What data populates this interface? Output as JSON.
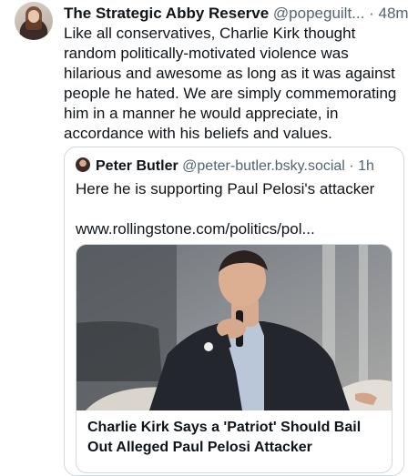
{
  "post": {
    "author": "The Strategic Abby Reserve",
    "handle": "@popeguilt...",
    "separator": "·",
    "time": "48m",
    "text": "Like all conservatives, Charlie Kirk thought random politically-motivated violence was hilarious and awesome as long as it was against people he hated. We are simply commemorating him in a manner he would appreciate, in accordance with his beliefs and values."
  },
  "quote": {
    "author": "Peter Butler",
    "handle": "@peter-butler.bsky.social",
    "separator": "·",
    "time": "1h",
    "text": "Here he is supporting Paul Pelosi's attacker",
    "url": "www.rollingstone.com/politics/pol...",
    "link_card": {
      "title": "Charlie Kirk Says a 'Patriot' Should Bail Out Alleged Paul Pelosi Attacker"
    }
  }
}
